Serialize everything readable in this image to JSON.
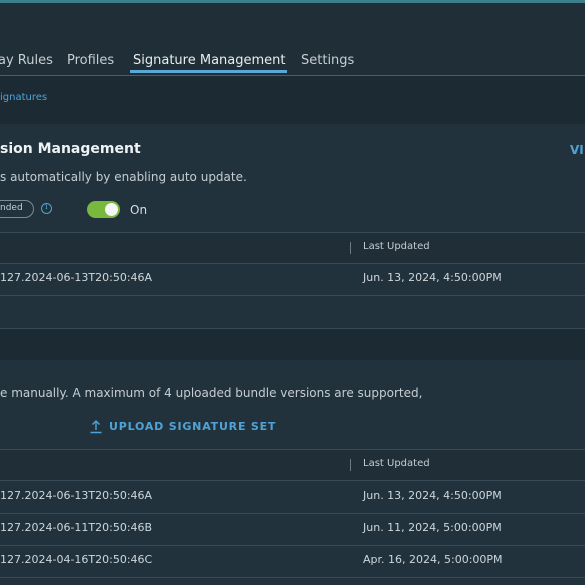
{
  "tabs": [
    {
      "label": "ay Rules"
    },
    {
      "label": "Profiles"
    },
    {
      "label": "Signature Management"
    },
    {
      "label": "Settings"
    }
  ],
  "breadcrumb": "ignatures",
  "section1": {
    "title": "sion Management",
    "view_link": "VI",
    "description": "s automatically by enabling auto update.",
    "pill_label": "nded",
    "toggle": {
      "label": "On",
      "state": "on"
    },
    "table": {
      "last_updated_header": "Last Updated",
      "rows": [
        {
          "name": "127.2024-06-13T20:50:46A",
          "updated": "Jun. 13, 2024, 4:50:00PM"
        }
      ]
    }
  },
  "section2": {
    "description": "e manually. A maximum of 4 uploaded bundle versions are supported,",
    "upload_label": "UPLOAD SIGNATURE SET",
    "table": {
      "last_updated_header": "Last Updated",
      "rows": [
        {
          "name": "127.2024-06-13T20:50:46A",
          "updated": "Jun. 13, 2024, 4:50:00PM"
        },
        {
          "name": "127.2024-06-11T20:50:46B",
          "updated": "Jun. 11, 2024, 5:00:00PM"
        },
        {
          "name": "127.2024-04-16T20:50:46C",
          "updated": "Apr. 16, 2024, 5:00:00PM"
        }
      ]
    }
  },
  "colors": {
    "accent": "#4fa3d6",
    "toggle_on": "#78b83c",
    "background": "#1b2a33",
    "panel": "#22323c"
  },
  "icons": {
    "info": "info-icon",
    "upload": "upload-icon"
  }
}
